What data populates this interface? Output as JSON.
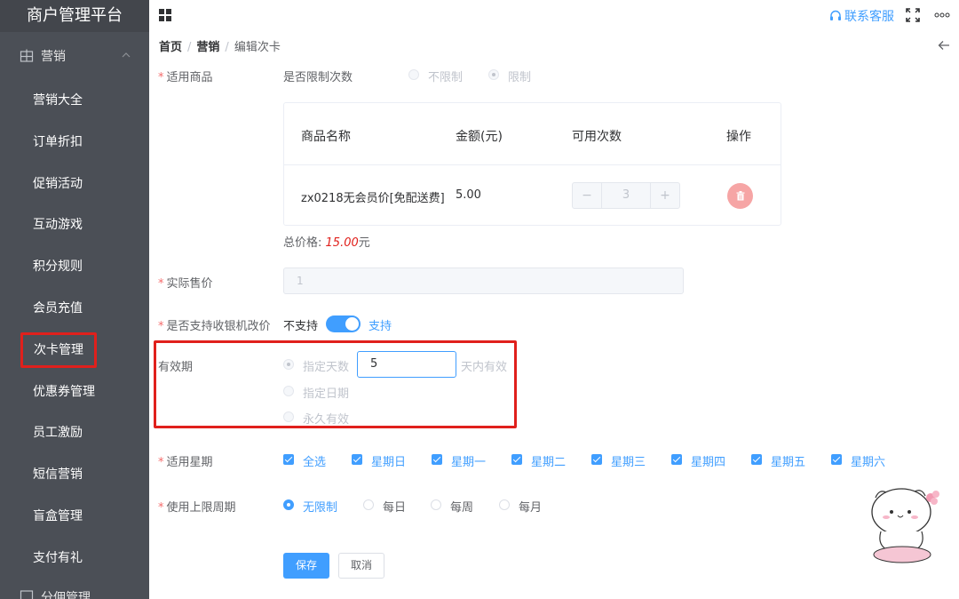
{
  "sidebar": {
    "brand": "商户管理平台",
    "group": "营销",
    "items": [
      {
        "label": "营销大全"
      },
      {
        "label": "订单折扣"
      },
      {
        "label": "促销活动"
      },
      {
        "label": "互动游戏"
      },
      {
        "label": "积分规则"
      },
      {
        "label": "会员充值"
      },
      {
        "label": "次卡管理"
      },
      {
        "label": "优惠券管理"
      },
      {
        "label": "员工激励"
      },
      {
        "label": "短信营销"
      },
      {
        "label": "盲盒管理"
      },
      {
        "label": "支付有礼"
      }
    ],
    "next_group": "分佣管理"
  },
  "header": {
    "service_label": "联系客服"
  },
  "breadcrumb": {
    "home": "首页",
    "section": "营销",
    "current": "编辑次卡",
    "sep": "/"
  },
  "form": {
    "required_mark": "*",
    "applicable_goods": {
      "label": "适用商品",
      "limit_label": "是否限制次数",
      "option_unlimited": "不限制",
      "option_limited": "限制",
      "selected": "限制"
    },
    "table": {
      "headers": [
        "商品名称",
        "金额(元)",
        "可用次数",
        "操作"
      ],
      "rows": [
        {
          "name": "zx0218无会员价[免配送费]",
          "amount": "5.00",
          "count": "3"
        }
      ],
      "stepper_minus": "−",
      "stepper_plus": "+"
    },
    "total": {
      "label": "总价格:",
      "value": "15.00",
      "unit": "元"
    },
    "actual_price": {
      "label": "实际售价",
      "value": "1"
    },
    "cashier_change": {
      "label": "是否支持收银机改价",
      "off_label": "不支持",
      "on_label": "支持",
      "enabled": true
    },
    "validity": {
      "label": "有效期",
      "option_days": "指定天数",
      "days_value": "5",
      "days_suffix": "天内有效",
      "option_date": "指定日期",
      "option_forever": "永久有效"
    },
    "weekdays": {
      "label": "适用星期",
      "options": [
        "全选",
        "星期日",
        "星期一",
        "星期二",
        "星期三",
        "星期四",
        "星期五",
        "星期六"
      ]
    },
    "period": {
      "label": "使用上限周期",
      "options": [
        "无限制",
        "每日",
        "每周",
        "每月"
      ],
      "selected": "无限制"
    },
    "save_label": "保存",
    "cancel_label": "取消"
  },
  "colors": {
    "primary": "#409eff",
    "sidebar_bg": "#4b4f56",
    "highlight_red": "#e0201c",
    "delete_pink": "#f6a5a5"
  },
  "icons": {
    "sidebar_group": "grid-icon",
    "menu_toggle": "apps-icon",
    "service": "headset-icon",
    "fullscreen": "fullscreen-icon",
    "more": "more-icon",
    "back": "arrow-left-icon",
    "delete": "trash-icon"
  }
}
